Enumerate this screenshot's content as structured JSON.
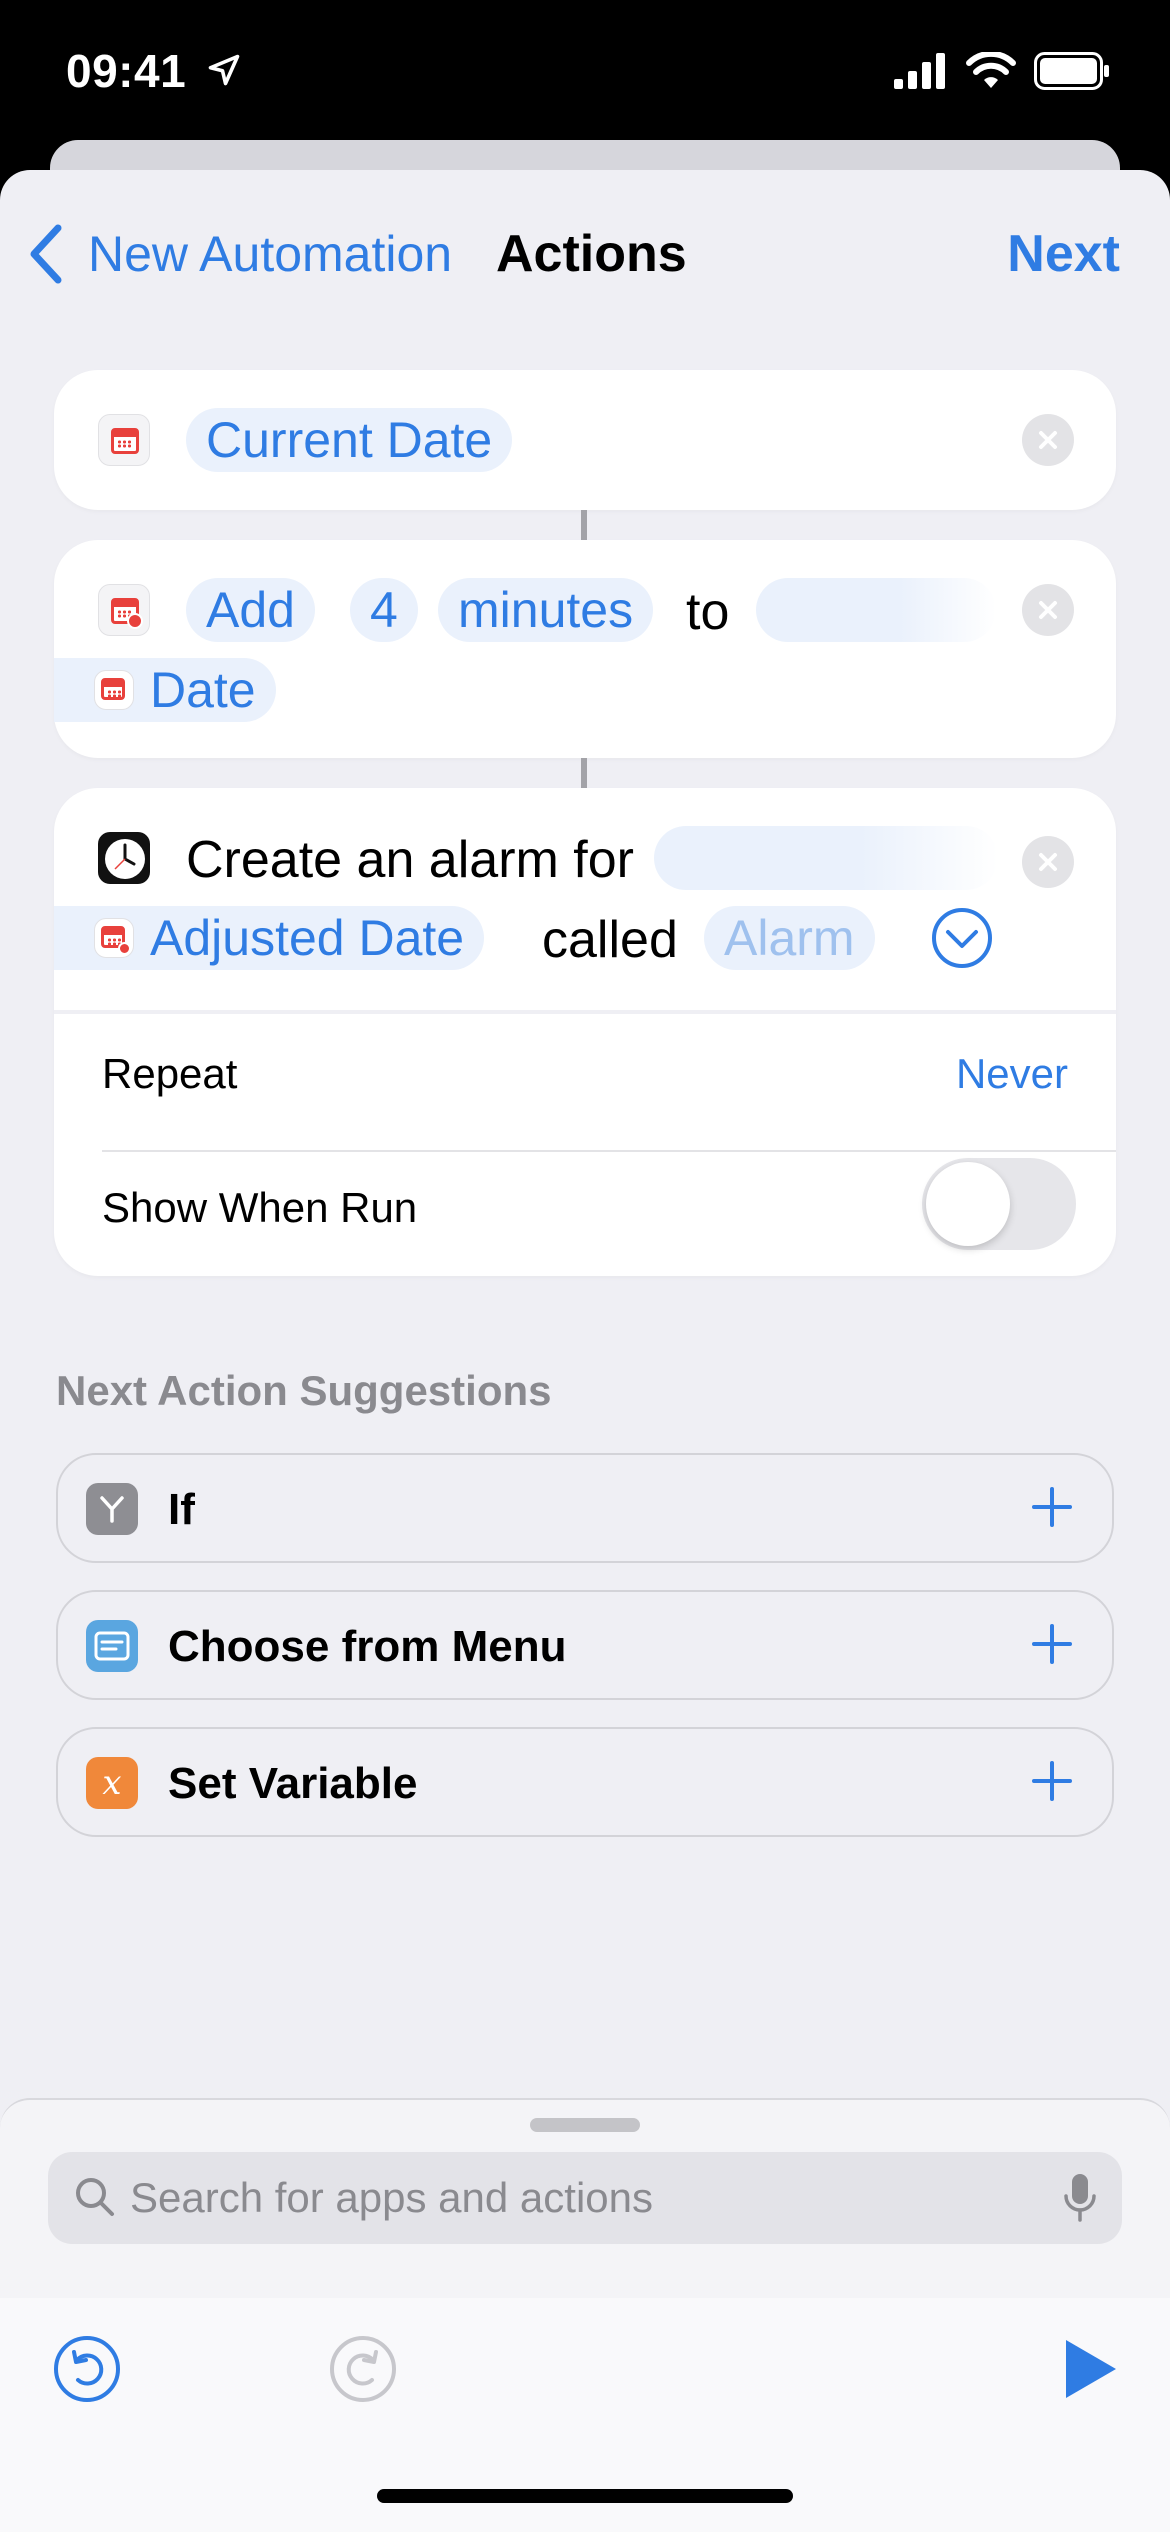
{
  "status": {
    "time": "09:41"
  },
  "nav": {
    "back_label": "New Automation",
    "title": "Actions",
    "next_label": "Next"
  },
  "actions": {
    "current_date": {
      "token": "Current Date"
    },
    "adjust_date": {
      "verb": "Add",
      "amount": "4",
      "unit": "minutes",
      "connector": "to",
      "target": "Date"
    },
    "create_alarm": {
      "text": "Create an alarm for",
      "date_token": "Adjusted Date",
      "called": "called",
      "name_placeholder": "Alarm",
      "repeat_label": "Repeat",
      "repeat_value": "Never",
      "show_when_run_label": "Show When Run",
      "show_when_run": false
    }
  },
  "suggestions": {
    "title": "Next Action Suggestions",
    "items": [
      {
        "label": "If",
        "icon": "branch-icon",
        "color": "#8e8e93"
      },
      {
        "label": "Choose from Menu",
        "icon": "menu-icon",
        "color": "#5aa6e0"
      },
      {
        "label": "Set Variable",
        "icon": "variable-icon",
        "color": "#f0883a",
        "glyph": "x"
      }
    ]
  },
  "search": {
    "placeholder": "Search for apps and actions"
  },
  "colors": {
    "accent": "#2f7ce3",
    "token_bg": "#eaf1fc",
    "calendar_red": "#e8413c"
  }
}
